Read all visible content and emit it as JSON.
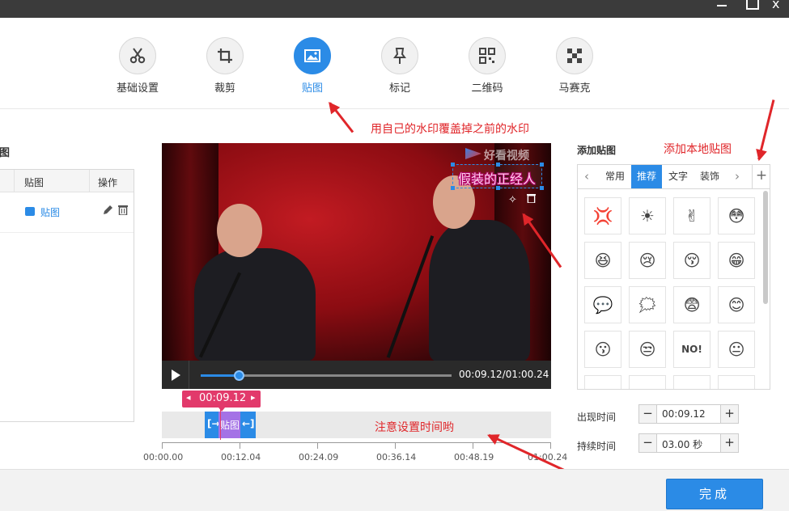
{
  "window": {
    "minimize_icon": "minimize-icon",
    "maximize_icon": "maximize-icon",
    "close_label": "x"
  },
  "toolbar": {
    "items": [
      {
        "label": "基础设置",
        "icon": "scissors-icon",
        "active": false
      },
      {
        "label": "裁剪",
        "icon": "crop-icon",
        "active": false
      },
      {
        "label": "贴图",
        "icon": "image-icon",
        "active": true
      },
      {
        "label": "标记",
        "icon": "pin-icon",
        "active": false
      },
      {
        "label": "二维码",
        "icon": "qrcode-icon",
        "active": false
      },
      {
        "label": "马赛克",
        "icon": "mosaic-icon",
        "active": false
      }
    ]
  },
  "left_panel": {
    "title": "贴图",
    "columns": [
      "贴图",
      "操作"
    ],
    "rows": [
      {
        "name": "贴图",
        "edit_icon": "pencil-icon",
        "delete_icon": "trash-icon"
      }
    ]
  },
  "video": {
    "watermark_text": "好看视频",
    "sticker_text": "假装的正经人",
    "current_time": "00:09.12",
    "total_time": "01:00.24",
    "time_display": "00:09.12/01:00.24",
    "progress": 0.15,
    "play_icon": "play-icon",
    "magic_icon": "magic-wand-icon",
    "delete_icon": "trash-icon"
  },
  "timeline": {
    "tag_time": "00:09.12",
    "clip_label": "贴图",
    "ticks": [
      "00:00.00",
      "00:12.04",
      "00:24.09",
      "00:36.14",
      "00:48.19",
      "01:00.24"
    ]
  },
  "right_panel": {
    "title": "添加贴图",
    "tabs": [
      "常用",
      "推荐",
      "文字",
      "装饰"
    ],
    "active_tab": "推荐",
    "add_label": "+",
    "appear_time_label": "出现时间",
    "appear_time_value": "00:09.12",
    "duration_label": "持续时间",
    "duration_value": "03.00 秒"
  },
  "stickers": [
    "💢",
    "☀",
    "✌",
    "😳",
    "😆",
    "😢",
    "😚",
    "😁",
    "💬",
    "🗯",
    "😨",
    "😊",
    "😗",
    "😒",
    "NO!",
    "😐"
  ],
  "annotations": {
    "cover_watermark": "用自己的水印覆盖掉之前的水印",
    "add_local": "添加本地贴图",
    "set_time": "注意设置时间哟"
  },
  "footer": {
    "done_label": "完成"
  },
  "colors": {
    "accent": "#2b8be6",
    "annotation": "#e0262a",
    "tag": "#e23a6b",
    "clip_mid": "#a472e6"
  }
}
